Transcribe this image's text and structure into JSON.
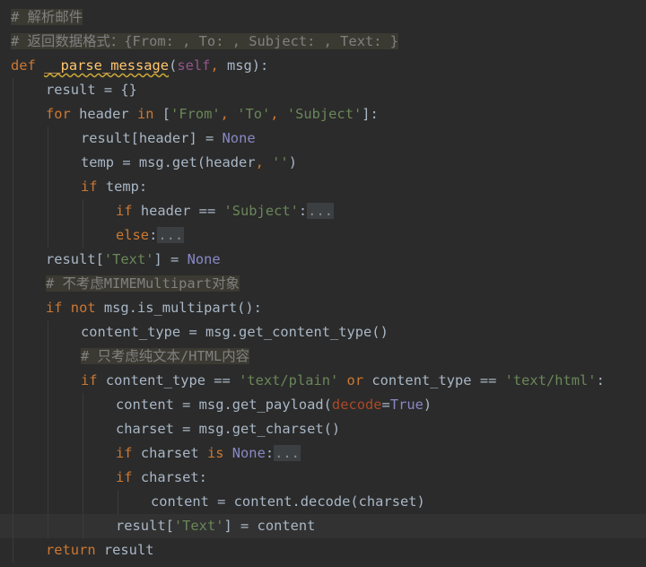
{
  "editor": {
    "colors": {
      "background": "#2b2b2b",
      "keyword": "#cc7832",
      "string": "#6a8759",
      "comment": "#808080",
      "function": "#ffc66d",
      "none": "#8888c6",
      "self": "#94558d",
      "param": "#aa4926",
      "text": "#a9b7c6"
    },
    "lines": [
      {
        "indent": 0,
        "tokens": [
          {
            "t": "cm box",
            "v": "# 解析邮件"
          }
        ]
      },
      {
        "indent": 0,
        "tokens": [
          {
            "t": "cm box",
            "v": "# 返回数据格式：{From: , To: , Subject: , Text: }"
          }
        ]
      },
      {
        "indent": 0,
        "tokens": [
          {
            "t": "kw",
            "v": "def "
          },
          {
            "t": "fn",
            "v": "__parse_message"
          },
          {
            "t": "",
            "v": "("
          },
          {
            "t": "selfk",
            "v": "self"
          },
          {
            "t": "kw",
            "v": ", "
          },
          {
            "t": "",
            "v": "msg):"
          }
        ]
      },
      {
        "indent": 1,
        "tokens": [
          {
            "t": "",
            "v": "result = {}"
          }
        ]
      },
      {
        "indent": 1,
        "tokens": [
          {
            "t": "kw",
            "v": "for "
          },
          {
            "t": "",
            "v": "header "
          },
          {
            "t": "kw",
            "v": "in "
          },
          {
            "t": "",
            "v": "["
          },
          {
            "t": "str",
            "v": "'From'"
          },
          {
            "t": "kw",
            "v": ", "
          },
          {
            "t": "str",
            "v": "'To'"
          },
          {
            "t": "kw",
            "v": ", "
          },
          {
            "t": "str",
            "v": "'Subject'"
          },
          {
            "t": "",
            "v": "]:"
          }
        ]
      },
      {
        "indent": 2,
        "tokens": [
          {
            "t": "",
            "v": "result[header] = "
          },
          {
            "t": "none",
            "v": "None"
          }
        ]
      },
      {
        "indent": 2,
        "tokens": [
          {
            "t": "",
            "v": "temp = msg.get(header"
          },
          {
            "t": "kw",
            "v": ", "
          },
          {
            "t": "str",
            "v": "''"
          },
          {
            "t": "",
            "v": ")"
          }
        ]
      },
      {
        "indent": 2,
        "tokens": [
          {
            "t": "kw",
            "v": "if "
          },
          {
            "t": "",
            "v": "temp:"
          }
        ]
      },
      {
        "indent": 3,
        "tokens": [
          {
            "t": "kw",
            "v": "if "
          },
          {
            "t": "",
            "v": "header == "
          },
          {
            "t": "str",
            "v": "'Subject'"
          },
          {
            "t": "",
            "v": ":"
          },
          {
            "t": "fold",
            "v": "..."
          }
        ]
      },
      {
        "indent": 3,
        "tokens": [
          {
            "t": "kw",
            "v": "else"
          },
          {
            "t": "",
            "v": ":"
          },
          {
            "t": "fold",
            "v": "..."
          }
        ]
      },
      {
        "indent": 1,
        "tokens": [
          {
            "t": "",
            "v": "result["
          },
          {
            "t": "str",
            "v": "'Text'"
          },
          {
            "t": "",
            "v": "] = "
          },
          {
            "t": "none",
            "v": "None"
          }
        ]
      },
      {
        "indent": 1,
        "tokens": [
          {
            "t": "cm box",
            "v": "# 不考虑MIMEMultipart对象"
          }
        ]
      },
      {
        "indent": 1,
        "tokens": [
          {
            "t": "kw",
            "v": "if not "
          },
          {
            "t": "",
            "v": "msg.is_multipart():"
          }
        ]
      },
      {
        "indent": 2,
        "tokens": [
          {
            "t": "",
            "v": "content_type = msg.get_content_type()"
          }
        ]
      },
      {
        "indent": 2,
        "tokens": [
          {
            "t": "cm box",
            "v": "# 只考虑纯文本/HTML内容"
          }
        ]
      },
      {
        "indent": 2,
        "tokens": [
          {
            "t": "kw",
            "v": "if "
          },
          {
            "t": "",
            "v": "content_type == "
          },
          {
            "t": "str",
            "v": "'text/plain' "
          },
          {
            "t": "kw",
            "v": "or "
          },
          {
            "t": "",
            "v": "content_type == "
          },
          {
            "t": "str",
            "v": "'text/html'"
          },
          {
            "t": "",
            "v": ":"
          }
        ]
      },
      {
        "indent": 3,
        "tokens": [
          {
            "t": "",
            "v": "content = msg.get_payload("
          },
          {
            "t": "param",
            "v": "decode"
          },
          {
            "t": "",
            "v": "="
          },
          {
            "t": "none",
            "v": "True"
          },
          {
            "t": "",
            "v": ")"
          }
        ]
      },
      {
        "indent": 3,
        "tokens": [
          {
            "t": "",
            "v": "charset = msg.get_charset()"
          }
        ]
      },
      {
        "indent": 3,
        "tokens": [
          {
            "t": "kw",
            "v": "if "
          },
          {
            "t": "",
            "v": "charset "
          },
          {
            "t": "kw",
            "v": "is "
          },
          {
            "t": "none",
            "v": "None"
          },
          {
            "t": "",
            "v": ":"
          },
          {
            "t": "fold",
            "v": "..."
          }
        ]
      },
      {
        "indent": 3,
        "tokens": [
          {
            "t": "kw",
            "v": "if "
          },
          {
            "t": "",
            "v": "charset:"
          }
        ]
      },
      {
        "indent": 4,
        "tokens": [
          {
            "t": "",
            "v": "content = content.decode(charset)"
          }
        ]
      },
      {
        "indent": 3,
        "current": true,
        "tokens": [
          {
            "t": "",
            "v": "result["
          },
          {
            "t": "str",
            "v": "'Text'"
          },
          {
            "t": "",
            "v": "] = content"
          }
        ]
      },
      {
        "indent": 1,
        "tokens": [
          {
            "t": "kw",
            "v": "return "
          },
          {
            "t": "",
            "v": "result"
          }
        ]
      }
    ]
  }
}
